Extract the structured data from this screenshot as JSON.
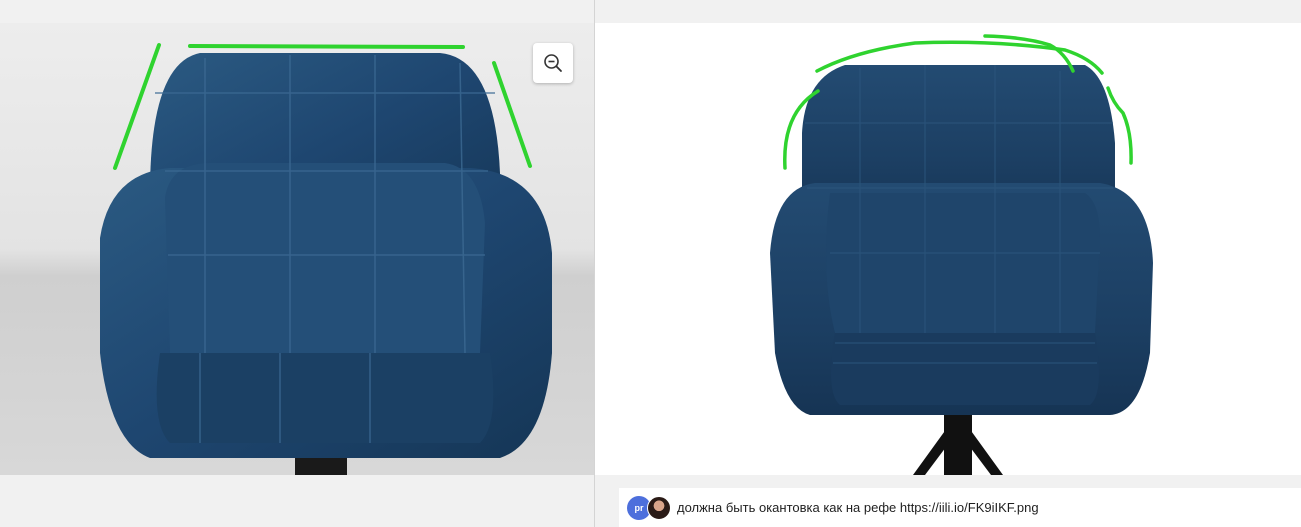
{
  "colors": {
    "annotation_stroke": "#2fd32f",
    "velvet_blue": "#1e4466",
    "avatar_initials_bg": "#4d6fdc"
  },
  "left_pane": {
    "zoom_button_icon": "zoom-out-icon"
  },
  "comment": {
    "author_initials": "pr",
    "text": "должна быть окантовка как на рефе https://iili.io/FK9iIKF.png"
  }
}
